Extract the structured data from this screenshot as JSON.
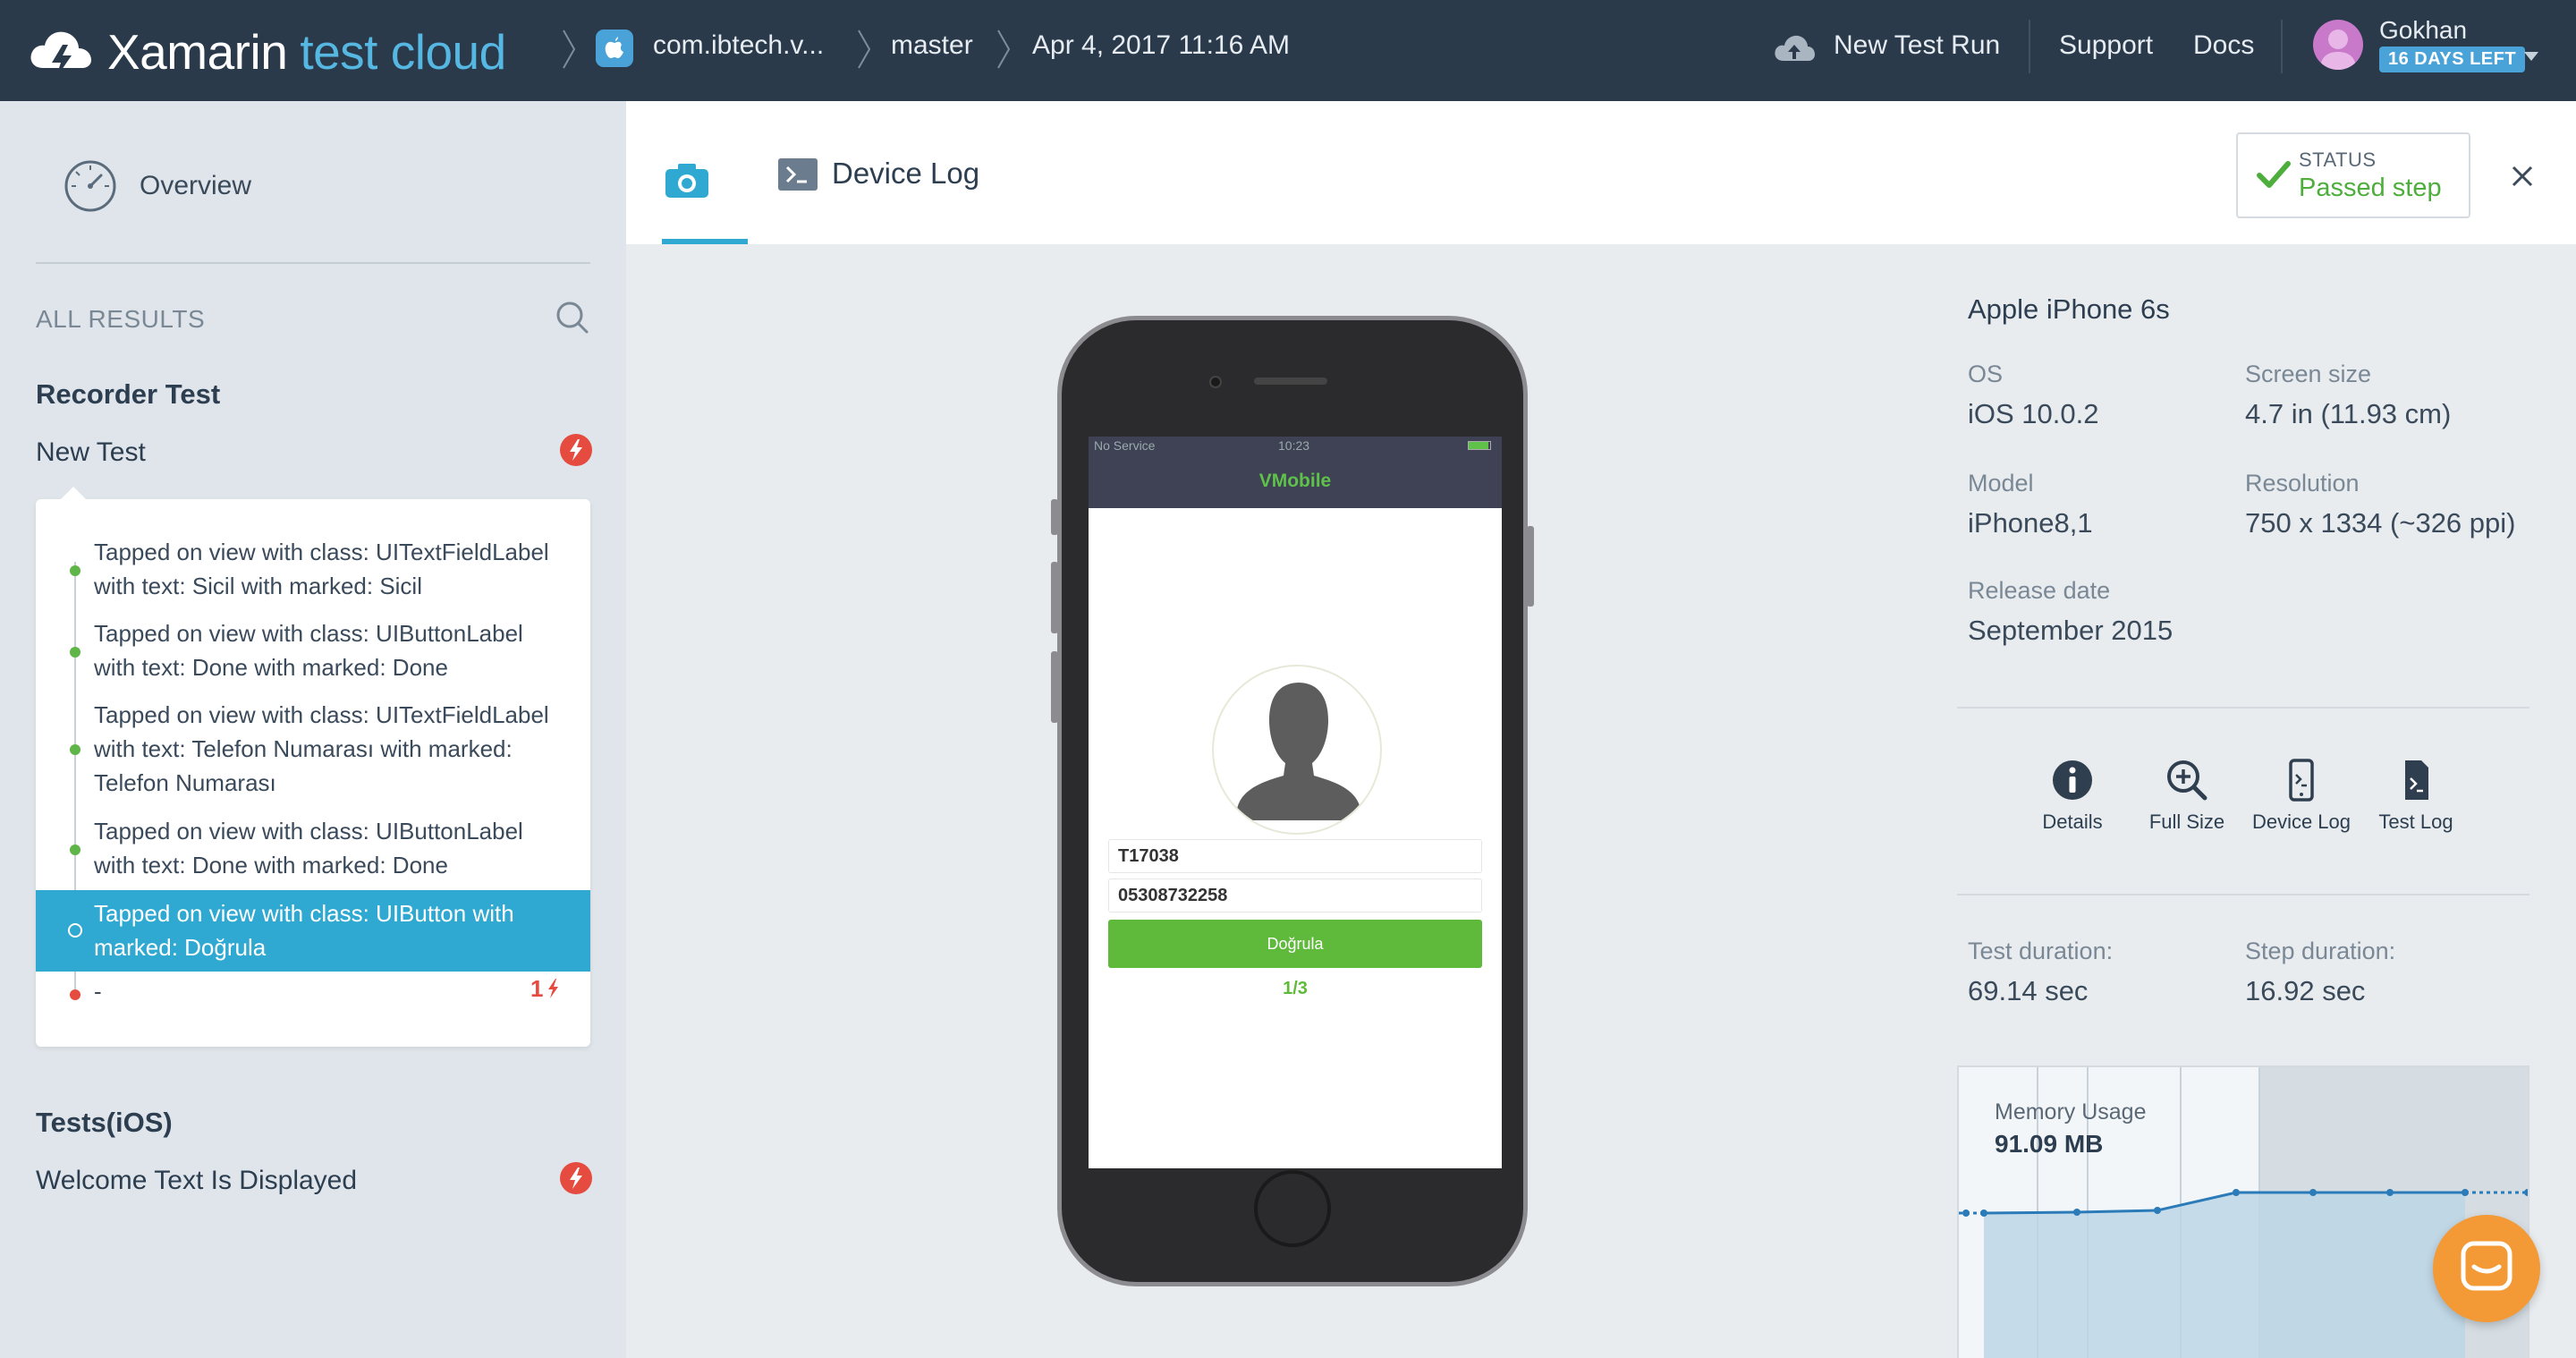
{
  "header": {
    "brand_name": "Xamarin",
    "brand_sub": "test cloud",
    "breadcrumbs": [
      "com.ibtech.v...",
      "master",
      "Apr 4, 2017 11:16 AM"
    ],
    "new_test_run": "New Test Run",
    "support": "Support",
    "docs": "Docs",
    "user_name": "Gokhan",
    "days_left": "16 DAYS LEFT"
  },
  "sidebar": {
    "overview": "Overview",
    "all_results": "ALL RESULTS",
    "recorder_section": "Recorder Test",
    "new_test": "New Test",
    "steps": [
      "Tapped on view with class: UITextFieldLabel with text: Sicil with marked: Sicil",
      "Tapped on view with class: UIButtonLabel with text: Done with marked: Done",
      "Tapped on view with class: UITextFieldLabel with text: Telefon Numarası with marked: Telefon Numarası",
      "Tapped on view with class: UIButtonLabel with text: Done with marked: Done",
      "Tapped on view with class: UIButton with marked: Doğrula"
    ],
    "last_step": "-",
    "last_step_count": "1",
    "ios_section": "Tests(iOS)",
    "welcome_test": "Welcome Text Is Displayed"
  },
  "tabs": {
    "device_log": "Device Log"
  },
  "status": {
    "caption": "STATUS",
    "value": "Passed step"
  },
  "phone_screen": {
    "carrier": "No Service",
    "time": "10:23",
    "app_title": "VMobile",
    "field1": "T17038",
    "field2": "05308732258",
    "button": "Doğrula",
    "page": "1/3"
  },
  "device": {
    "title": "Apple iPhone 6s",
    "os_label": "OS",
    "os_value": "iOS 10.0.2",
    "screen_label": "Screen size",
    "screen_value": "4.7 in (11.93 cm)",
    "model_label": "Model",
    "model_value": "iPhone8,1",
    "resolution_label": "Resolution",
    "resolution_value": "750 x 1334 (~326 ppi)",
    "release_label": "Release date",
    "release_value": "September 2015"
  },
  "actions": {
    "details": "Details",
    "full_size": "Full Size",
    "device_log": "Device Log",
    "test_log": "Test Log"
  },
  "durations": {
    "test_label": "Test duration:",
    "test_value": "69.14 sec",
    "step_label": "Step duration:",
    "step_value": "16.92 sec"
  },
  "memory": {
    "label": "Memory Usage",
    "value": "91.09 MB"
  },
  "colors": {
    "topbar": "#2a3a4b",
    "accent": "#2fa9d2",
    "success": "#4eae3c",
    "fail": "#e54b3f",
    "chat": "#f39a36"
  }
}
